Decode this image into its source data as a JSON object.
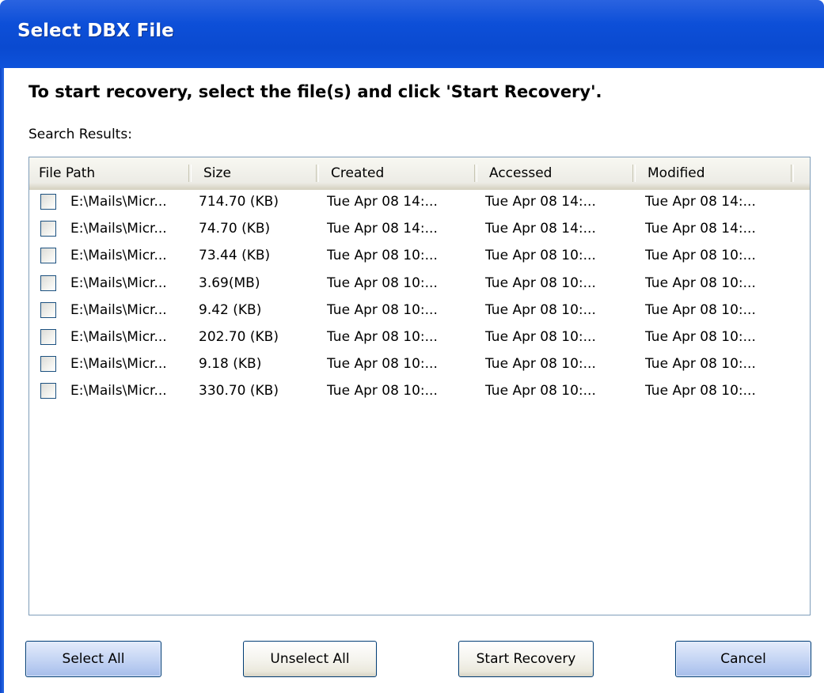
{
  "window": {
    "title": "Select DBX File"
  },
  "instruction": "To start recovery, select the file(s) and click 'Start Recovery'.",
  "search_results_label": "Search Results:",
  "table": {
    "columns": [
      "File Path",
      "Size",
      "Created",
      "Accessed",
      "Modified"
    ],
    "rows": [
      {
        "path": "E:\\Mails\\Micr...",
        "size": "714.70 (KB)",
        "created": "Tue Apr 08 14:...",
        "accessed": "Tue Apr 08 14:...",
        "modified": "Tue Apr 08 14:...",
        "checked": false
      },
      {
        "path": "E:\\Mails\\Micr...",
        "size": "74.70 (KB)",
        "created": "Tue Apr 08 14:...",
        "accessed": "Tue Apr 08 14:...",
        "modified": "Tue Apr 08 14:...",
        "checked": false
      },
      {
        "path": "E:\\Mails\\Micr...",
        "size": "73.44 (KB)",
        "created": "Tue Apr 08 10:...",
        "accessed": "Tue Apr 08 10:...",
        "modified": "Tue Apr 08 10:...",
        "checked": false
      },
      {
        "path": "E:\\Mails\\Micr...",
        "size": "3.69(MB)",
        "created": "Tue Apr 08 10:...",
        "accessed": "Tue Apr 08 10:...",
        "modified": "Tue Apr 08 10:...",
        "checked": false
      },
      {
        "path": "E:\\Mails\\Micr...",
        "size": "9.42 (KB)",
        "created": "Tue Apr 08 10:...",
        "accessed": "Tue Apr 08 10:...",
        "modified": "Tue Apr 08 10:...",
        "checked": false
      },
      {
        "path": "E:\\Mails\\Micr...",
        "size": "202.70 (KB)",
        "created": "Tue Apr 08 10:...",
        "accessed": "Tue Apr 08 10:...",
        "modified": "Tue Apr 08 10:...",
        "checked": false
      },
      {
        "path": "E:\\Mails\\Micr...",
        "size": "9.18 (KB)",
        "created": "Tue Apr 08 10:...",
        "accessed": "Tue Apr 08 10:...",
        "modified": "Tue Apr 08 10:...",
        "checked": false
      },
      {
        "path": "E:\\Mails\\Micr...",
        "size": "330.70 (KB)",
        "created": "Tue Apr 08 10:...",
        "accessed": "Tue Apr 08 10:...",
        "modified": "Tue Apr 08 10:...",
        "checked": false
      }
    ]
  },
  "buttons": {
    "select_all": "Select All",
    "unselect_all": "Unselect All",
    "start_recovery": "Start Recovery",
    "cancel": "Cancel"
  },
  "colors": {
    "title_bar": "#0d4fd8",
    "title_text": "#ffffff",
    "list_border": "#7f9db9",
    "header_bg": "#ecebe5",
    "blue_button": "#b3c7ef"
  }
}
